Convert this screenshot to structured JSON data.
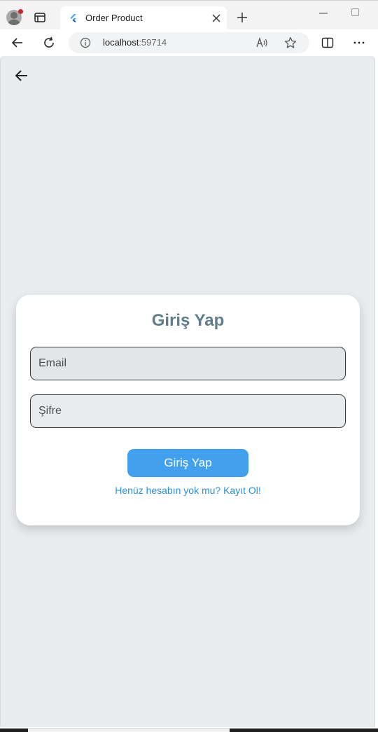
{
  "browser": {
    "tab_title": "Order Product",
    "url_host": "localhost",
    "url_port": ":59714"
  },
  "login_card": {
    "title": "Giriş Yap",
    "email_placeholder": "Email",
    "password_placeholder": "Şifre",
    "submit_label": "Giriş Yap",
    "register_link": "Henüz hesabın yok mu? Kayıt Ol!"
  },
  "colors": {
    "page_background": "#e9ecef",
    "title_color": "#607d8b",
    "button_color": "#42a0ee",
    "link_color": "#2a8fd8"
  },
  "icons": [
    "profile-icon",
    "tab-actions-icon",
    "flutter-favicon-icon",
    "close-icon",
    "plus-icon",
    "back-arrow-icon",
    "reload-icon",
    "info-icon",
    "read-aloud-icon",
    "star-icon",
    "split-screen-icon",
    "more-icon",
    "page-back-arrow-icon"
  ]
}
